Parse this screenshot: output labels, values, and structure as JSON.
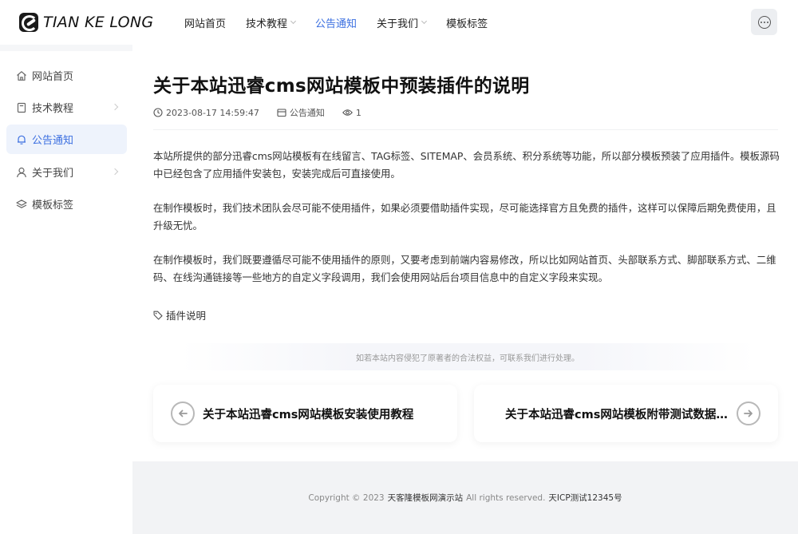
{
  "header": {
    "logo_text": "TIAN KE LONG",
    "nav": [
      {
        "label": "网站首页",
        "has_dropdown": false,
        "active": false
      },
      {
        "label": "技术教程",
        "has_dropdown": true,
        "active": false
      },
      {
        "label": "公告通知",
        "has_dropdown": false,
        "active": true
      },
      {
        "label": "关于我们",
        "has_dropdown": true,
        "active": false
      },
      {
        "label": "模板标签",
        "has_dropdown": false,
        "active": false
      }
    ],
    "menu_icon": "more-dots-icon"
  },
  "sidebar": {
    "items": [
      {
        "label": "网站首页",
        "icon": "home-icon",
        "has_children": false,
        "active": false
      },
      {
        "label": "技术教程",
        "icon": "document-icon",
        "has_children": true,
        "active": false
      },
      {
        "label": "公告通知",
        "icon": "bell-icon",
        "has_children": false,
        "active": true
      },
      {
        "label": "关于我们",
        "icon": "user-icon",
        "has_children": true,
        "active": false
      },
      {
        "label": "模板标签",
        "icon": "layers-icon",
        "has_children": false,
        "active": false
      }
    ]
  },
  "article": {
    "title": "关于本站迅睿cms网站模板中预装插件的说明",
    "datetime": "2023-08-17 14:59:47",
    "category": "公告通知",
    "views": "1",
    "paragraphs": [
      "本站所提供的部分迅睿cms网站模板有在线留言、TAG标签、SITEMAP、会员系统、积分系统等功能，所以部分模板预装了应用插件。模板源码中已经包含了应用插件安装包，安装完成后可直接使用。",
      "在制作模板时，我们技术团队会尽可能不使用插件，如果必须要借助插件实现，尽可能选择官方且免费的插件，这样可以保障后期免费使用，且升级无忧。",
      "在制作模板时，我们既要遵循尽可能不使用插件的原则，又要考虑到前端内容易修改，所以比如网站首页、头部联系方式、脚部联系方式、二维码、在线沟通链接等一些地方的自定义字段调用，我们会使用网站后台项目信息中的自定义字段来实现。"
    ],
    "tag": "插件说明",
    "notice": "如若本站内容侵犯了原著者的合法权益，可联系我们进行处理。"
  },
  "post_nav": {
    "prev_title": "关于本站迅睿cms网站模板安装使用教程",
    "next_title": "关于本站迅睿cms网站模板附带测试数据的说明"
  },
  "footer": {
    "copyright": "Copyright © 2023",
    "site_name": "天客隆模板网演示站",
    "rights": "All rights reserved.",
    "icp": "天ICP测试12345号"
  },
  "colors": {
    "accent": "#3b6fe0",
    "active_bg": "#eef3fc",
    "page_bg": "#f5f6f8"
  }
}
